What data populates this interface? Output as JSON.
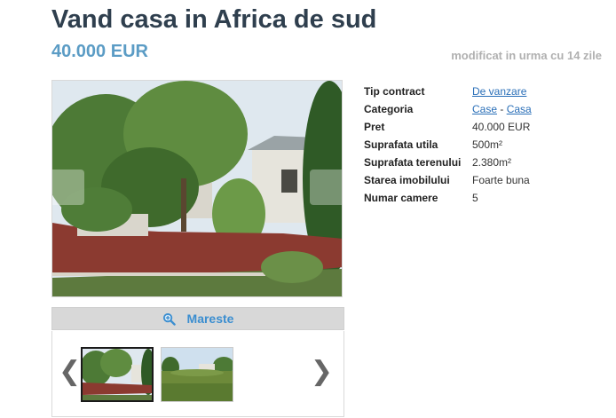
{
  "listing": {
    "title": "Vand casa in Africa de sud",
    "price": "40.000 EUR",
    "modified": "modificat in urma cu 14 zile"
  },
  "gallery": {
    "enlarge_label": "Mareste",
    "prev_glyph": "❮",
    "next_glyph": "❯",
    "thumbnail_count": 2
  },
  "details": {
    "contract": {
      "label": "Tip contract",
      "value": "De vanzare"
    },
    "category": {
      "label": "Categoria",
      "value_main": "Case",
      "separator": " - ",
      "value_sub": "Casa"
    },
    "price": {
      "label": "Pret",
      "value": "40.000 EUR"
    },
    "usable_area": {
      "label": "Suprafata utila",
      "value": "500m²"
    },
    "land_area": {
      "label": "Suprafata terenului",
      "value": "2.380m²"
    },
    "condition": {
      "label": "Starea imobilului",
      "value": "Foarte buna"
    },
    "rooms": {
      "label": "Numar camere",
      "value": "5"
    }
  },
  "icons": {
    "enlarge": "magnifier-zoom-icon",
    "prev": "chevron-left-icon",
    "next": "chevron-right-icon"
  },
  "colors": {
    "title": "#2f3f4e",
    "price": "#5b9cc5",
    "link": "#2a6fb8",
    "accent_blue": "#3b8ed0"
  }
}
